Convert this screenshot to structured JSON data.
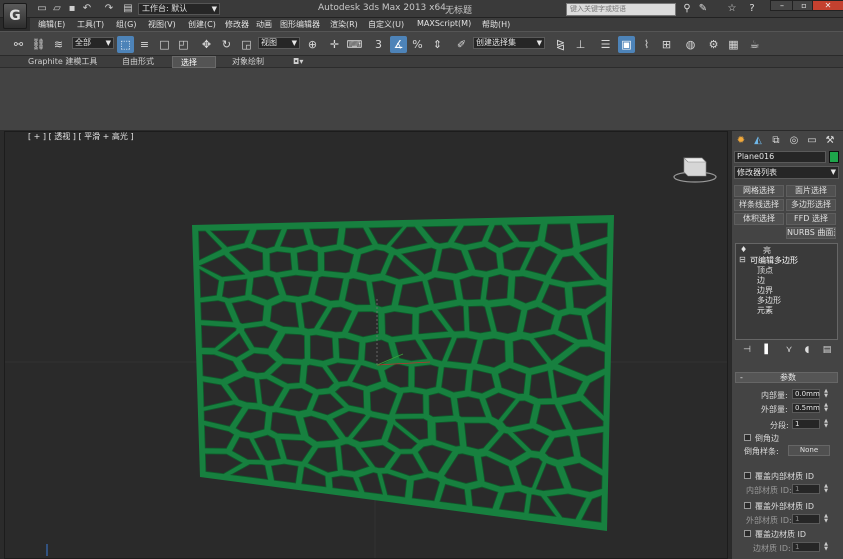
{
  "title_bar": {
    "app_title": "Autodesk 3ds Max  2013 x64",
    "document": "无标题",
    "workspace": "工作台: 默认",
    "search_placeholder": "键入关键字或短语",
    "logo_letter": "G"
  },
  "menu": [
    "编辑(E)",
    "工具(T)",
    "组(G)",
    "视图(V)",
    "创建(C)",
    "修改器",
    "动画",
    "图形编辑器",
    "渲染(R)",
    "自定义(U)",
    "MAXScript(M)",
    "帮助(H)"
  ],
  "toolbar": {
    "selection_filter": "全部",
    "ref_coord": "视图",
    "named_selection": "创建选择集",
    "spinner_snap": "3"
  },
  "ribbon": {
    "tabs": [
      "Graphite 建模工具",
      "自由形式",
      "选择",
      "对象绘制"
    ],
    "active_tab": "选择"
  },
  "viewport": {
    "label": "[ + ] [ 透视 ] [ 平滑 + 高光 ]",
    "object_color": "#17803f"
  },
  "command_panel": {
    "object_name": "Plane016",
    "object_color": "#1ea64b",
    "modifier_list": "修改器列表",
    "mod_buttons": [
      "网格选择",
      "面片选择",
      "样条线选择",
      "多边形选择",
      "体积选择",
      "FFD 选择",
      "NURBS 曲面选择"
    ],
    "stack": {
      "light": "亮",
      "base": "可编辑多边形",
      "subobjects": [
        "顶点",
        "边",
        "边界",
        "多边形",
        "元素"
      ]
    },
    "rollout_title": "参数",
    "params": {
      "inner_amount_label": "内部量:",
      "inner_amount": "0.0mm",
      "outer_amount_label": "外部量:",
      "outer_amount": "0.5mm",
      "segments_label": "分段:",
      "segments": "1",
      "chamfer_edges": "倒角边",
      "chamfer_spline_label": "倒角样条:",
      "chamfer_spline": "None",
      "override_inner": "覆盖内部材质 ID",
      "inner_id_label": "内部材质 ID:",
      "inner_id": "1",
      "override_outer": "覆盖外部材质 ID",
      "outer_id_label": "外部材质 ID:",
      "outer_id": "1",
      "override_edge": "覆盖边材质 ID",
      "edge_id_label": "边材质 ID:",
      "edge_id": "1"
    }
  }
}
